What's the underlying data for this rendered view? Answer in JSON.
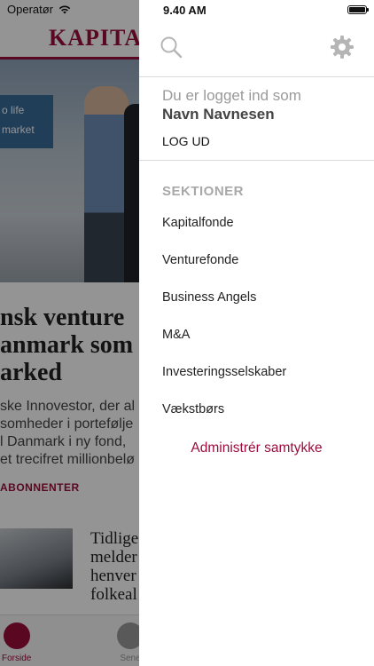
{
  "background": {
    "carrier": "Operatør",
    "logo": "KAPITAL",
    "hero_sign": [
      "o life",
      "market"
    ],
    "headline": [
      "nsk venture",
      "anmark som",
      "arked"
    ],
    "body": [
      "ske Innovestor, der al",
      "somheder i portefølje",
      "l Danmark i ny fond,",
      "et trecifret millionbelø"
    ],
    "subscribers_label": "ABONNENTER",
    "teaser": [
      "Tidlige",
      "melder",
      "henver",
      "folkeal"
    ],
    "tabs": [
      {
        "label": "Forside",
        "color": "#9b0e3c"
      },
      {
        "label": "Sene",
        "color": "#999999"
      }
    ]
  },
  "drawer": {
    "time": "9.40 AM",
    "logged_in_label": "Du er logget ind som",
    "user_name": "Navn Navnesen",
    "logout_label": "LOG UD",
    "sections_title": "SEKTIONER",
    "sections": [
      "Kapitalfonde",
      "Venturefonde",
      "Business Angels",
      "M&A",
      "Investeringsselskaber",
      "Vækstbørs"
    ],
    "consent_label": "Administrér samtykke",
    "icons": {
      "search": "search-icon",
      "settings": "gear-icon"
    },
    "accent_color": "#9b0e3c"
  }
}
